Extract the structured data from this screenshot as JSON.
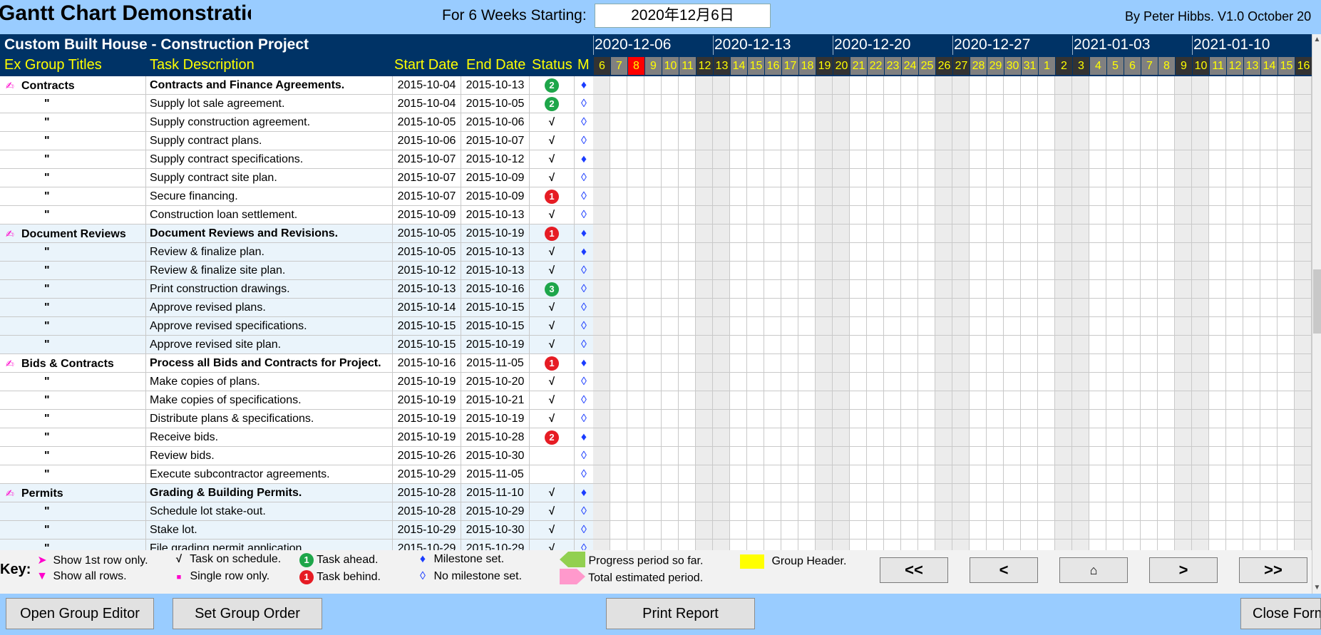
{
  "app": {
    "title": "Gantt Chart Demonstration",
    "weeks_label": "For 6 Weeks Starting:",
    "start_date": "2020年12月6日",
    "author": "By Peter Hibbs.  V1.0  October 20"
  },
  "project": {
    "title": "Custom Built House - Construction Project",
    "columns": {
      "group": "Ex Group Titles",
      "desc": "Task Description",
      "start": "Start Date",
      "end": "End Date",
      "status": "Status",
      "m": "M"
    }
  },
  "weeks": [
    "2020-12-06",
    "2020-12-13",
    "2020-12-20",
    "2020-12-27",
    "2021-01-03",
    "2021-01-10"
  ],
  "days": [
    "6",
    "7",
    "8",
    "9",
    "10",
    "11",
    "12",
    "13",
    "14",
    "15",
    "16",
    "17",
    "18",
    "19",
    "20",
    "21",
    "22",
    "23",
    "24",
    "25",
    "26",
    "27",
    "28",
    "29",
    "30",
    "31",
    "1",
    "2",
    "3",
    "4",
    "5",
    "6",
    "7",
    "8",
    "9",
    "10",
    "11",
    "12",
    "13",
    "14",
    "15",
    "16"
  ],
  "colors": {
    "header_bg": "#003366",
    "header_text": "#ffff00",
    "top_bar": "#99ccff",
    "today": "#ff0000",
    "weekday_cell": "#808080",
    "weekend_cell": "#333333",
    "status_ahead": "#1ea64a",
    "status_behind": "#e61c24",
    "milestone": "#1a3cff",
    "group_pen": "#ff00cc"
  },
  "tasks": [
    {
      "group": "Contracts",
      "desc": "Contracts and Finance Agreements.",
      "start": "2015-10-04",
      "end": "2015-10-13",
      "status": "2",
      "status_type": "ahead",
      "milestone": "set",
      "header": true
    },
    {
      "group": "\"",
      "desc": "Supply lot sale agreement.",
      "start": "2015-10-04",
      "end": "2015-10-05",
      "status": "2",
      "status_type": "ahead",
      "milestone": "none"
    },
    {
      "group": "\"",
      "desc": "Supply construction agreement.",
      "start": "2015-10-05",
      "end": "2015-10-06",
      "status": "√",
      "status_type": "check",
      "milestone": "none"
    },
    {
      "group": "\"",
      "desc": "Supply contract plans.",
      "start": "2015-10-06",
      "end": "2015-10-07",
      "status": "√",
      "status_type": "check",
      "milestone": "none"
    },
    {
      "group": "\"",
      "desc": "Supply contract specifications.",
      "start": "2015-10-07",
      "end": "2015-10-12",
      "status": "√",
      "status_type": "check",
      "milestone": "set"
    },
    {
      "group": "\"",
      "desc": "Supply contract site plan.",
      "start": "2015-10-07",
      "end": "2015-10-09",
      "status": "√",
      "status_type": "check",
      "milestone": "none"
    },
    {
      "group": "\"",
      "desc": "Secure financing.",
      "start": "2015-10-07",
      "end": "2015-10-09",
      "status": "1",
      "status_type": "behind",
      "milestone": "none"
    },
    {
      "group": "\"",
      "desc": "Construction loan settlement.",
      "start": "2015-10-09",
      "end": "2015-10-13",
      "status": "√",
      "status_type": "check",
      "milestone": "none"
    },
    {
      "group": "Document Reviews",
      "desc": "Document Reviews and Revisions.",
      "start": "2015-10-05",
      "end": "2015-10-19",
      "status": "1",
      "status_type": "behind",
      "milestone": "set",
      "header": true
    },
    {
      "group": "\"",
      "desc": "Review & finalize plan.",
      "start": "2015-10-05",
      "end": "2015-10-13",
      "status": "√",
      "status_type": "check",
      "milestone": "set"
    },
    {
      "group": "\"",
      "desc": "Review & finalize site plan.",
      "start": "2015-10-12",
      "end": "2015-10-13",
      "status": "√",
      "status_type": "check",
      "milestone": "none"
    },
    {
      "group": "\"",
      "desc": "Print construction drawings.",
      "start": "2015-10-13",
      "end": "2015-10-16",
      "status": "3",
      "status_type": "ahead",
      "milestone": "none"
    },
    {
      "group": "\"",
      "desc": "Approve revised plans.",
      "start": "2015-10-14",
      "end": "2015-10-15",
      "status": "√",
      "status_type": "check",
      "milestone": "none"
    },
    {
      "group": "\"",
      "desc": "Approve revised specifications.",
      "start": "2015-10-15",
      "end": "2015-10-15",
      "status": "√",
      "status_type": "check",
      "milestone": "none"
    },
    {
      "group": "\"",
      "desc": "Approve revised site plan.",
      "start": "2015-10-15",
      "end": "2015-10-19",
      "status": "√",
      "status_type": "check",
      "milestone": "none"
    },
    {
      "group": "Bids & Contracts",
      "desc": "Process all Bids and Contracts for Project.",
      "start": "2015-10-16",
      "end": "2015-11-05",
      "status": "1",
      "status_type": "behind",
      "milestone": "set",
      "header": true
    },
    {
      "group": "\"",
      "desc": "Make copies of plans.",
      "start": "2015-10-19",
      "end": "2015-10-20",
      "status": "√",
      "status_type": "check",
      "milestone": "none"
    },
    {
      "group": "\"",
      "desc": "Make copies of specifications.",
      "start": "2015-10-19",
      "end": "2015-10-21",
      "status": "√",
      "status_type": "check",
      "milestone": "none"
    },
    {
      "group": "\"",
      "desc": "Distribute plans & specifications.",
      "start": "2015-10-19",
      "end": "2015-10-19",
      "status": "√",
      "status_type": "check",
      "milestone": "none"
    },
    {
      "group": "\"",
      "desc": "Receive bids.",
      "start": "2015-10-19",
      "end": "2015-10-28",
      "status": "2",
      "status_type": "behind",
      "milestone": "set"
    },
    {
      "group": "\"",
      "desc": "Review bids.",
      "start": "2015-10-26",
      "end": "2015-10-30",
      "status": "",
      "status_type": "none",
      "milestone": "none"
    },
    {
      "group": "\"",
      "desc": "Execute subcontractor agreements.",
      "start": "2015-10-29",
      "end": "2015-11-05",
      "status": "",
      "status_type": "none",
      "milestone": "none"
    },
    {
      "group": "Permits",
      "desc": "Grading & Building Permits.",
      "start": "2015-10-28",
      "end": "2015-11-10",
      "status": "√",
      "status_type": "check",
      "milestone": "set",
      "header": true
    },
    {
      "group": "\"",
      "desc": "Schedule lot stake-out.",
      "start": "2015-10-28",
      "end": "2015-10-29",
      "status": "√",
      "status_type": "check",
      "milestone": "none"
    },
    {
      "group": "\"",
      "desc": "Stake lot.",
      "start": "2015-10-29",
      "end": "2015-10-30",
      "status": "√",
      "status_type": "check",
      "milestone": "none"
    },
    {
      "group": "\"",
      "desc": "File grading permit application.",
      "start": "2015-10-29",
      "end": "2015-10-29",
      "status": "√",
      "status_type": "check",
      "milestone": "none"
    }
  ],
  "key": {
    "title": "Key:",
    "show_first": "Show 1st row only.",
    "show_all": "Show all rows.",
    "on_schedule": "Task on schedule.",
    "single_row": "Single row only.",
    "ahead": "Task ahead.",
    "behind": "Task behind.",
    "ms_set": "Milestone set.",
    "ms_none": "No milestone set.",
    "progress": "Progress period so far.",
    "estimated": "Total estimated period.",
    "group_header": "Group Header.",
    "check_sym": "√",
    "ahead_num": "1",
    "behind_num": "1"
  },
  "nav": {
    "first": "<<",
    "prev": "<",
    "home": "⌂",
    "next": ">",
    "last": ">>"
  },
  "buttons": {
    "group_editor": "Open Group Editor",
    "group_order": "Set Group Order",
    "print": "Print Report",
    "close": "Close Form"
  }
}
